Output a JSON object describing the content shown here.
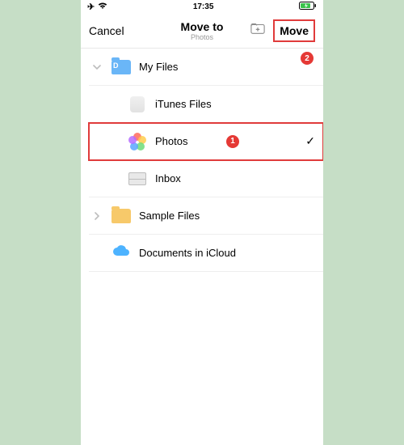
{
  "status": {
    "time": "17:35"
  },
  "nav": {
    "cancel": "Cancel",
    "title": "Move to",
    "subtitle": "Photos",
    "move": "Move"
  },
  "annotations": {
    "badge1": "1",
    "badge2": "2"
  },
  "rows": {
    "myfiles": "My Files",
    "itunes": "iTunes Files",
    "photos": "Photos",
    "inbox": "Inbox",
    "sample": "Sample Files",
    "icloud": "Documents in iCloud"
  }
}
